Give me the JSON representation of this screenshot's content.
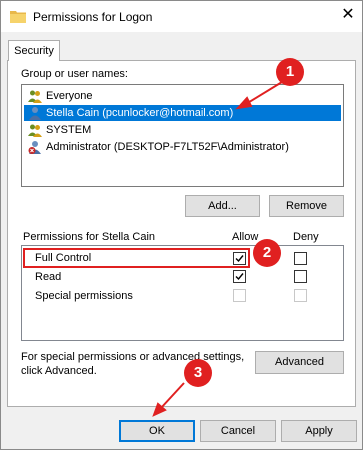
{
  "window": {
    "title": "Permissions for Logon",
    "close_glyph": "✕"
  },
  "tab": {
    "label": "Security"
  },
  "group_label": "Group or user names:",
  "users": [
    {
      "name": "Everyone",
      "icon": "group-icon"
    },
    {
      "name": "Stella Cain (pcunlocker@hotmail.com)",
      "icon": "user-icon",
      "selected": true
    },
    {
      "name": "SYSTEM",
      "icon": "group-icon"
    },
    {
      "name": "Administrator (DESKTOP-F7LT52F\\Administrator)",
      "icon": "admin-user-icon"
    }
  ],
  "buttons": {
    "add": "Add...",
    "remove": "Remove",
    "advanced": "Advanced",
    "ok": "OK",
    "cancel": "Cancel",
    "apply": "Apply"
  },
  "permissions": {
    "header": "Permissions for Stella Cain",
    "allow_header": "Allow",
    "deny_header": "Deny",
    "rows": [
      {
        "name": "Full Control",
        "allow": true,
        "deny": false,
        "disabled": false
      },
      {
        "name": "Read",
        "allow": true,
        "deny": false,
        "disabled": false
      },
      {
        "name": "Special permissions",
        "allow": false,
        "deny": false,
        "disabled": true
      }
    ]
  },
  "advanced_text_line1": "For special permissions or advanced settings,",
  "advanced_text_line2": "click Advanced.",
  "callouts": [
    "1",
    "2",
    "3"
  ],
  "colors": {
    "accent": "#0078d7",
    "annotation": "#e02020"
  }
}
